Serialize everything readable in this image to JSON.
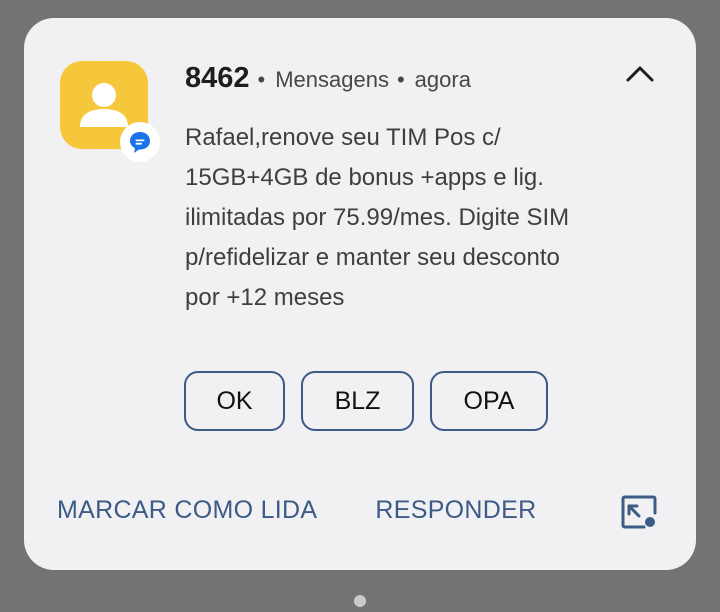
{
  "notification": {
    "sender": "8462",
    "app_name": "Mensagens",
    "time": "agora",
    "separator": "•",
    "message_lines": [
      "Rafael,renove seu TIM Pos c/",
      "15GB+4GB de bonus +apps e lig.",
      "ilimitadas por 75.99/mes. Digite SIM",
      "p/refidelizar e manter seu desconto",
      "por +12 meses"
    ],
    "avatar_icon": "person-icon",
    "app_badge_icon": "messages-bubble-icon",
    "collapse_icon": "chevron-up-icon",
    "quick_replies": [
      "OK",
      "BLZ",
      "OPA"
    ],
    "actions": {
      "mark_read": "MARCAR COMO LIDA",
      "reply": "RESPONDER"
    },
    "bubble_icon": "open-as-bubble-icon"
  },
  "colors": {
    "avatar_bg": "#f6c73b",
    "accent": "#3c5b86",
    "badge_blue": "#1a73e8"
  }
}
